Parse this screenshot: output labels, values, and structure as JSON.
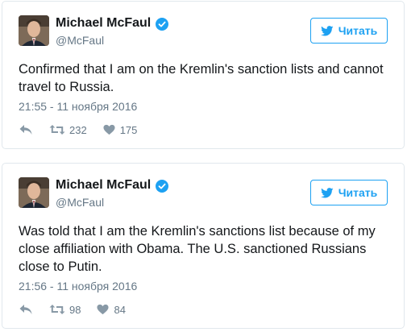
{
  "tweets": [
    {
      "author_name": "Michael McFaul",
      "handle": "@McFaul",
      "follow_label": "Читать",
      "text": "Confirmed that I am on the Kremlin's sanction lists and cannot travel to Russia.",
      "timestamp": "21:55 - 11 ноября 2016",
      "retweets": "232",
      "likes": "175"
    },
    {
      "author_name": "Michael McFaul",
      "handle": "@McFaul",
      "follow_label": "Читать",
      "text": "Was told that I am the Kremlin's sanctions list because of my close affiliation with Obama. The U.S. sanctioned Russians close to Putin.",
      "timestamp": "21:56 - 11 ноября 2016",
      "retweets": "98",
      "likes": "84"
    }
  ],
  "colors": {
    "accent": "#1da1f2",
    "muted": "#657786",
    "border": "#e1e8ed",
    "text": "#14171a"
  },
  "icons": {
    "verified": "verified-badge-icon",
    "bird": "twitter-bird-icon",
    "reply": "reply-icon",
    "retweet": "retweet-icon",
    "like": "heart-icon"
  }
}
